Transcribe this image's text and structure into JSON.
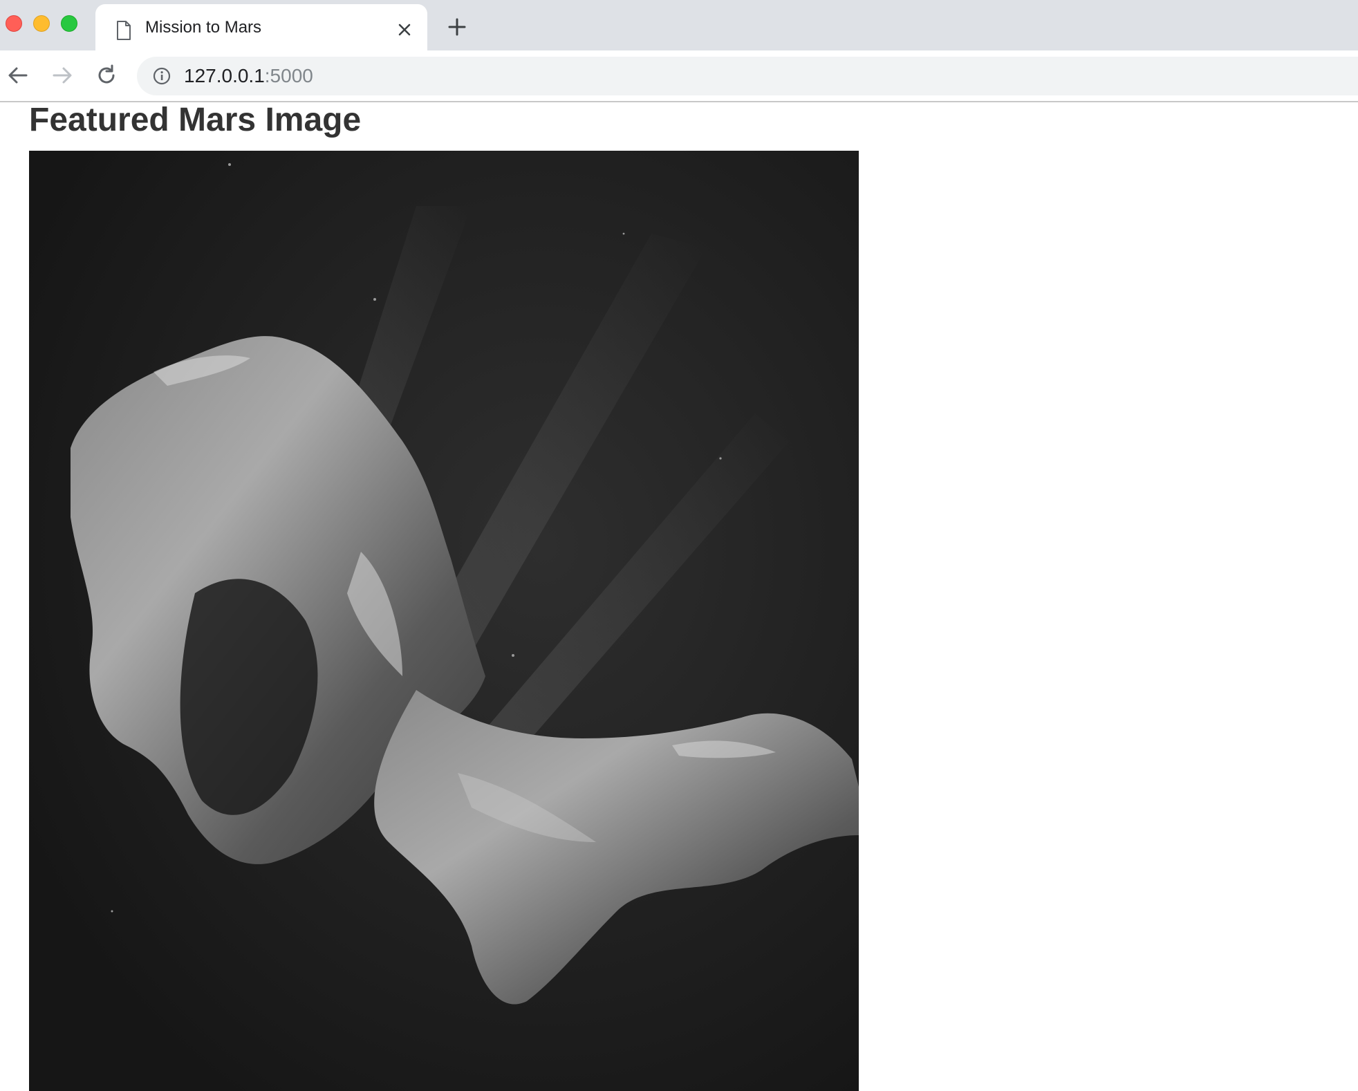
{
  "browser": {
    "tab": {
      "title": "Mission to Mars"
    },
    "address_bar": {
      "host": "127.0.0.1",
      "port": ":5000"
    }
  },
  "page": {
    "heading": "Featured Mars Image",
    "featured_image": {
      "alt": "Featured Mars Image"
    }
  },
  "colors": {
    "close_dot": "#ff5f57",
    "minimize_dot": "#febc2e",
    "maximize_dot": "#28c840",
    "tab_strip": "#dee1e6",
    "omnibox": "#f1f3f4"
  }
}
